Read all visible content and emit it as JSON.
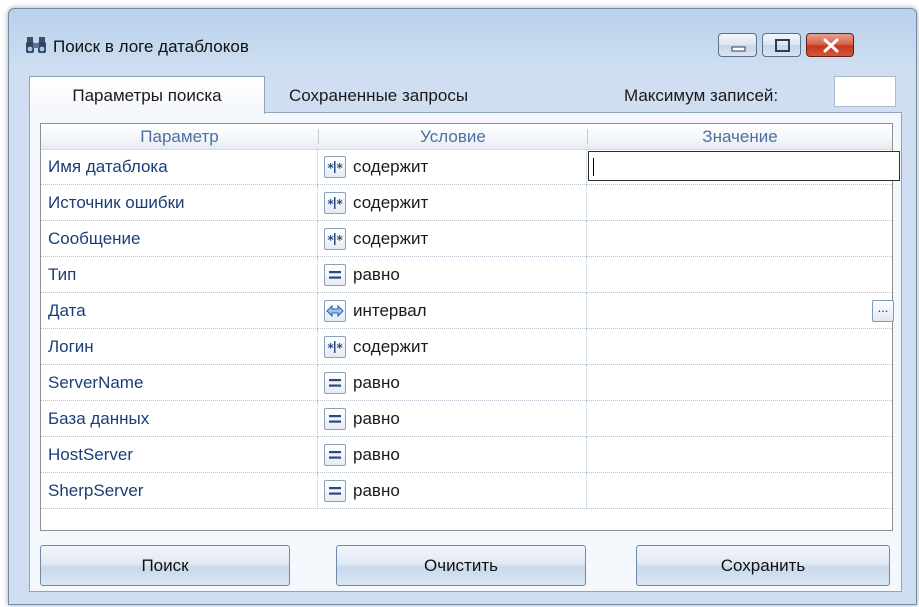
{
  "window": {
    "title": "Поиск в логе датаблоков",
    "icon": "binoculars-icon",
    "controls": [
      "minimize-icon",
      "maximize-icon",
      "close-icon"
    ]
  },
  "tabs": [
    {
      "label": "Параметры поиска",
      "active": true
    },
    {
      "label": "Сохраненные запросы",
      "active": false
    }
  ],
  "max_records": {
    "label": "Максимум записей:",
    "value": ""
  },
  "grid": {
    "columns": [
      "Параметр",
      "Условие",
      "Значение"
    ],
    "rows": [
      {
        "param": "Имя датаблока",
        "cond_icon": "wildcard-icon",
        "cond": "содержит",
        "value": "",
        "focused": true
      },
      {
        "param": "Источник ошибки",
        "cond_icon": "wildcard-icon",
        "cond": "содержит",
        "value": ""
      },
      {
        "param": "Сообщение",
        "cond_icon": "wildcard-icon",
        "cond": "содержит",
        "value": ""
      },
      {
        "param": "Тип",
        "cond_icon": "equals-icon",
        "cond": "равно",
        "value": ""
      },
      {
        "param": "Дата",
        "cond_icon": "interval-arrow-icon",
        "cond": "интервал",
        "value": "",
        "has_button": true
      },
      {
        "param": "Логин",
        "cond_icon": "wildcard-icon",
        "cond": "содержит",
        "value": ""
      },
      {
        "param": "ServerName",
        "cond_icon": "equals-icon",
        "cond": "равно",
        "value": ""
      },
      {
        "param": "База данных",
        "cond_icon": "equals-icon",
        "cond": "равно",
        "value": ""
      },
      {
        "param": "HostServer",
        "cond_icon": "equals-icon",
        "cond": "равно",
        "value": ""
      },
      {
        "param": "SherpServer",
        "cond_icon": "equals-icon",
        "cond": "равно",
        "value": ""
      }
    ],
    "ellipsis_label": "..."
  },
  "buttons": {
    "search": "Поиск",
    "clear": "Очистить",
    "save": "Сохранить"
  },
  "colors": {
    "accent": "#1a3e78",
    "header_text": "#4d6fa2",
    "close_button": "#c4381b",
    "window_frame": "#cfdff1"
  }
}
